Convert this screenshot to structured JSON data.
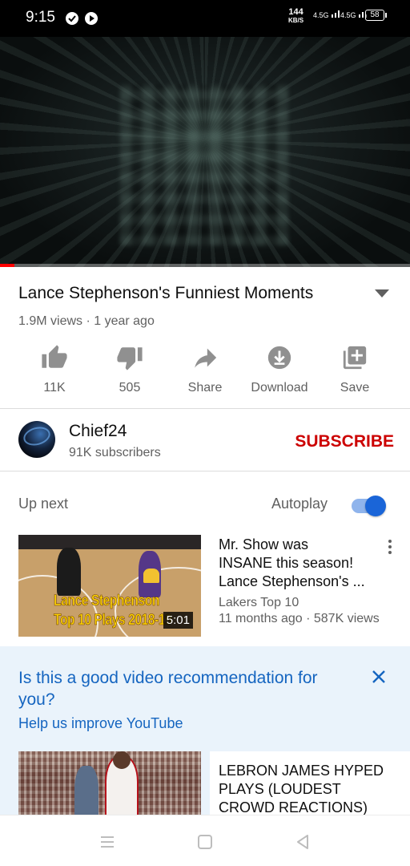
{
  "status_bar": {
    "time": "9:15",
    "net_speed_value": "144",
    "net_speed_unit": "KB/S",
    "signal1": "4.5G",
    "signal2": "4.5G",
    "battery": "58"
  },
  "player": {
    "progress_fraction": 0.035,
    "progress_color": "#ff0000"
  },
  "video": {
    "title": "Lance Stephenson's Funniest Moments",
    "meta": "1.9M views · 1 year ago"
  },
  "actions": [
    {
      "label": "11K",
      "icon": "thumb-up-icon"
    },
    {
      "label": "505",
      "icon": "thumb-down-icon"
    },
    {
      "label": "Share",
      "icon": "share-icon"
    },
    {
      "label": "Download",
      "icon": "download-icon"
    },
    {
      "label": "Save",
      "icon": "save-playlist-icon"
    }
  ],
  "channel": {
    "name": "Chief24",
    "subscribers": "91K subscribers",
    "subscribe_label": "SUBSCRIBE"
  },
  "up_next": {
    "label": "Up next",
    "autoplay_label": "Autoplay",
    "autoplay_on": true
  },
  "recommendations": [
    {
      "title_lines": [
        "Mr. Show was",
        "INSANE this season!",
        "Lance Stephenson's ..."
      ],
      "channel": "Lakers Top 10",
      "meta": "11 months ago · 587K views",
      "duration": "5:01",
      "thumb_text_1": "Lance Stephenson",
      "thumb_text_2": "Top 10 Plays 2018-19"
    },
    {
      "title_lines": [
        "LEBRON JAMES HYPED",
        "PLAYS (LOUDEST",
        "CROWD REACTIONS)"
      ]
    }
  ],
  "feedback": {
    "title": "Is this a good video recommendation for you?",
    "subtitle": "Help us improve YouTube"
  },
  "colors": {
    "accent_red": "#cc0000",
    "accent_blue": "#1565c0",
    "toggle_blue": "#1a65d8"
  }
}
